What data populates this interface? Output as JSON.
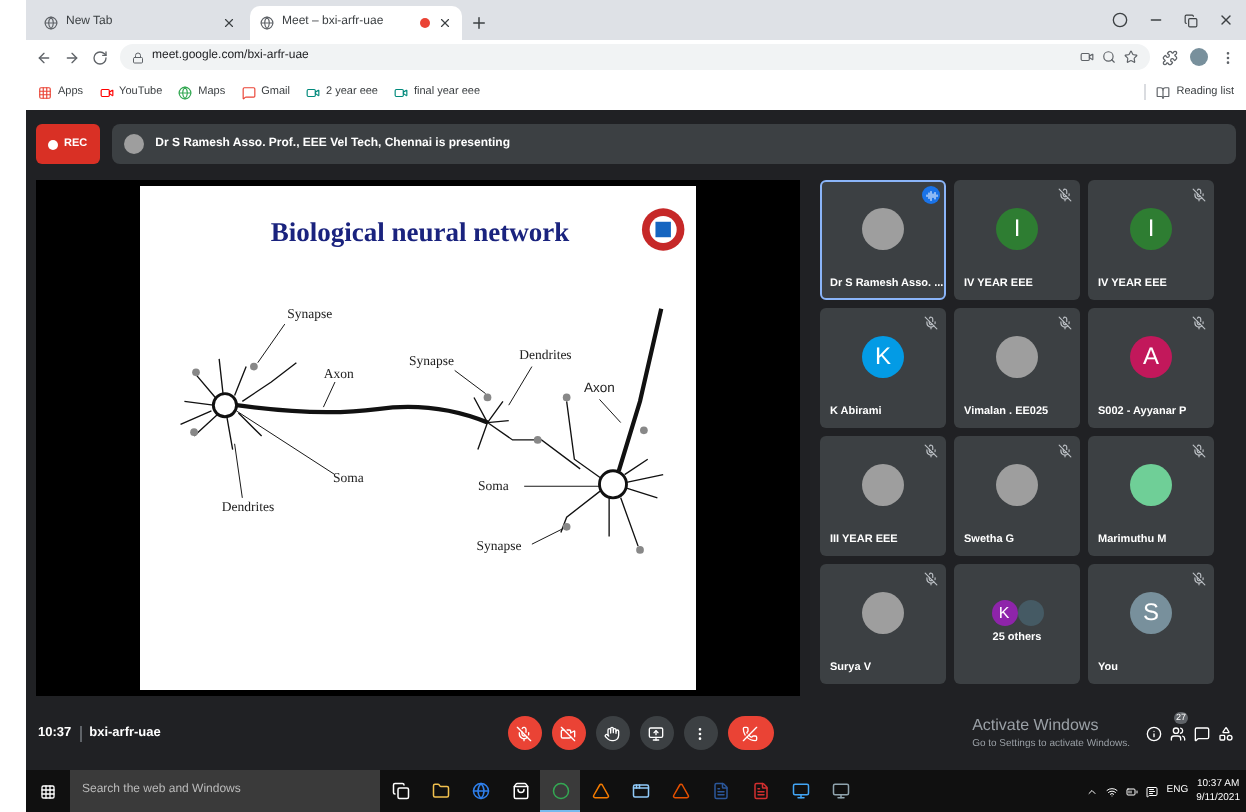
{
  "browser": {
    "tabs": [
      {
        "title": "New Tab",
        "selected": false,
        "recording": false
      },
      {
        "title": "Meet – bxi-arfr-uae",
        "selected": true,
        "recording": true
      }
    ],
    "address": "meet.google.com/bxi-arfr-uae",
    "bookmarks": [
      {
        "label": "Apps",
        "kind": "apps"
      },
      {
        "label": "YouTube",
        "kind": "youtube"
      },
      {
        "label": "Maps",
        "kind": "maps"
      },
      {
        "label": "Gmail",
        "kind": "gmail"
      },
      {
        "label": "2 year eee",
        "kind": "meet"
      },
      {
        "label": "final year eee",
        "kind": "meet"
      }
    ],
    "reading_list": "Reading list"
  },
  "meet": {
    "rec": "REC",
    "presenting": "Dr S Ramesh Asso. Prof., EEE Vel Tech, Chennai is presenting",
    "slide": {
      "title": "Biological neural network",
      "labels": [
        "Synapse",
        "Axon",
        "Synapse",
        "Dendrites",
        "Axon",
        "Soma",
        "Dendrites",
        "Soma",
        "Synapse"
      ]
    },
    "participants": [
      {
        "name": "Dr S Ramesh Asso. ...",
        "kind": "photo",
        "speaking": true,
        "muted": false
      },
      {
        "name": "IV YEAR EEE",
        "kind": "initial",
        "initial": "I",
        "color": "#2e7d32",
        "speaking": false,
        "muted": true
      },
      {
        "name": "IV YEAR EEE",
        "kind": "initial",
        "initial": "I",
        "color": "#2e7d32",
        "speaking": false,
        "muted": true
      },
      {
        "name": "K Abirami",
        "kind": "initial",
        "initial": "K",
        "color": "#039be5",
        "speaking": false,
        "muted": true
      },
      {
        "name": "Vimalan . EE025",
        "kind": "photo",
        "speaking": false,
        "muted": true
      },
      {
        "name": "S002 - Ayyanar P",
        "kind": "initial",
        "initial": "A",
        "color": "#c2185b",
        "speaking": false,
        "muted": true
      },
      {
        "name": "III YEAR EEE",
        "kind": "photo",
        "speaking": false,
        "muted": true
      },
      {
        "name": "Swetha G",
        "kind": "photo",
        "speaking": false,
        "muted": true
      },
      {
        "name": "Marimuthu M",
        "kind": "blank",
        "color": "#6fcf97",
        "speaking": false,
        "muted": true
      },
      {
        "name": "Surya V",
        "kind": "photo",
        "speaking": false,
        "muted": true
      },
      {
        "name": "25 others",
        "kind": "others",
        "initial": "K",
        "color": "#8e24aa",
        "speaking": false,
        "muted": false
      },
      {
        "name": "You",
        "kind": "initial",
        "initial": "S",
        "color": "#78909c",
        "speaking": false,
        "muted": true
      }
    ],
    "time": "10:37",
    "code": "bxi-arfr-uae",
    "people_count": "27"
  },
  "windows_notice": {
    "title": "Activate Windows",
    "text": "Go to Settings to activate Windows."
  },
  "taskbar": {
    "search": "Search the web and Windows",
    "apps": [
      {
        "kind": "taskview",
        "active": false
      },
      {
        "kind": "folder",
        "active": false
      },
      {
        "kind": "edge",
        "active": false
      },
      {
        "kind": "store",
        "active": false
      },
      {
        "kind": "chrome",
        "active": true
      },
      {
        "kind": "vlc",
        "active": false
      },
      {
        "kind": "window",
        "active": false
      },
      {
        "kind": "matlab",
        "active": false
      },
      {
        "kind": "word",
        "active": false
      },
      {
        "kind": "pdf",
        "active": false
      },
      {
        "kind": "app",
        "active": false
      },
      {
        "kind": "network",
        "active": false
      }
    ],
    "language": "ENG",
    "time": "10:37 AM",
    "date": "9/11/2021"
  }
}
